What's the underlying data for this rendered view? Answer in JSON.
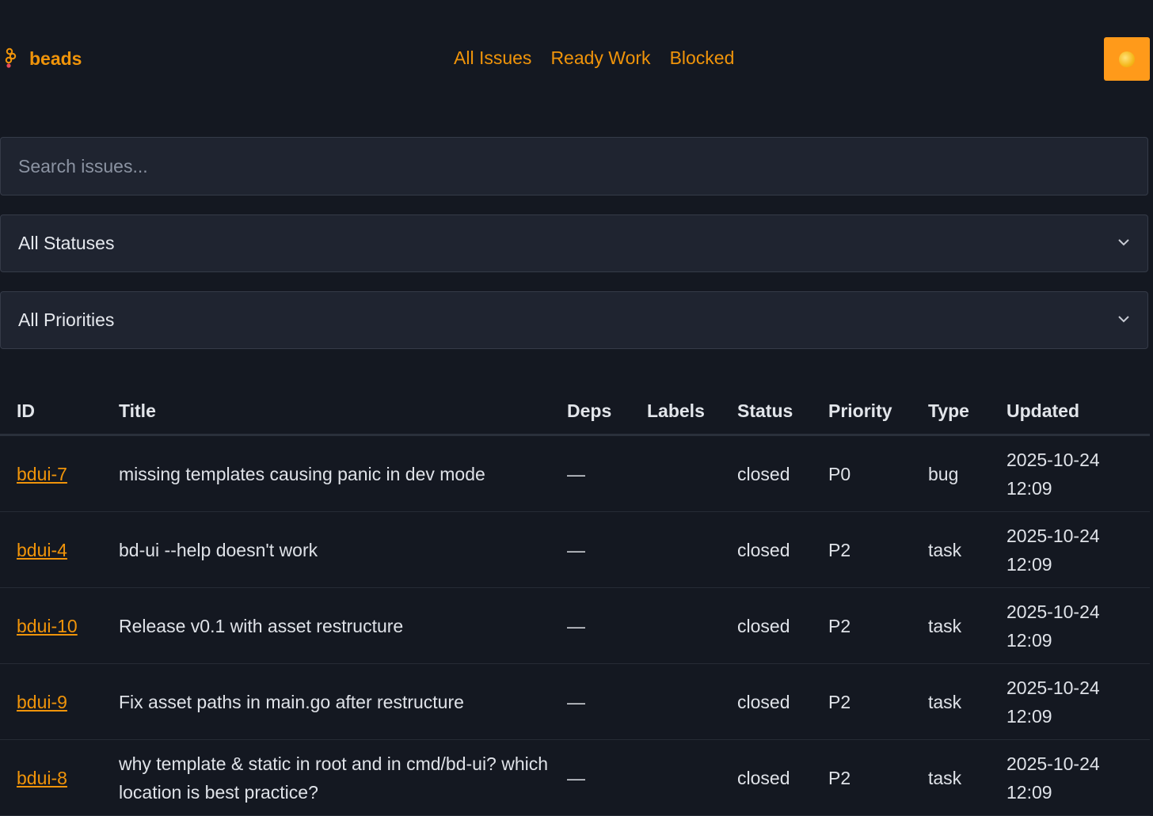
{
  "brand": {
    "name": "beads"
  },
  "nav": [
    {
      "label": "All Issues"
    },
    {
      "label": "Ready Work"
    },
    {
      "label": "Blocked"
    }
  ],
  "search": {
    "placeholder": "Search issues..."
  },
  "filters": {
    "status": {
      "selected": "All Statuses"
    },
    "priority": {
      "selected": "All Priorities"
    }
  },
  "table": {
    "headers": {
      "id": "ID",
      "title": "Title",
      "deps": "Deps",
      "labels": "Labels",
      "status": "Status",
      "priority": "Priority",
      "type": "Type",
      "updated": "Updated"
    },
    "rows": [
      {
        "id": "bdui-7",
        "title": "missing templates causing panic in dev mode",
        "deps": "—",
        "labels": "",
        "status": "closed",
        "priority": "P0",
        "type": "bug",
        "updated_date": "2025-10-24",
        "updated_time": "12:09"
      },
      {
        "id": "bdui-4",
        "title": "bd-ui --help doesn't work",
        "deps": "—",
        "labels": "",
        "status": "closed",
        "priority": "P2",
        "type": "task",
        "updated_date": "2025-10-24",
        "updated_time": "12:09"
      },
      {
        "id": "bdui-10",
        "title": "Release v0.1 with asset restructure",
        "deps": "—",
        "labels": "",
        "status": "closed",
        "priority": "P2",
        "type": "task",
        "updated_date": "2025-10-24",
        "updated_time": "12:09"
      },
      {
        "id": "bdui-9",
        "title": "Fix asset paths in main.go after restructure",
        "deps": "—",
        "labels": "",
        "status": "closed",
        "priority": "P2",
        "type": "task",
        "updated_date": "2025-10-24",
        "updated_time": "12:09"
      },
      {
        "id": "bdui-8",
        "title": "why template & static in root and in cmd/bd-ui? which location is best practice?",
        "deps": "—",
        "labels": "",
        "status": "closed",
        "priority": "P2",
        "type": "task",
        "updated_date": "2025-10-24",
        "updated_time": "12:09"
      }
    ]
  },
  "colors": {
    "background": "#141821",
    "accent": "#f0940a",
    "field_background": "#1f2430",
    "theme_button": "#ff9a1a"
  },
  "icons": {
    "brand": "beads-icon",
    "theme": "sun-icon",
    "select": "chevron-down-icon"
  }
}
